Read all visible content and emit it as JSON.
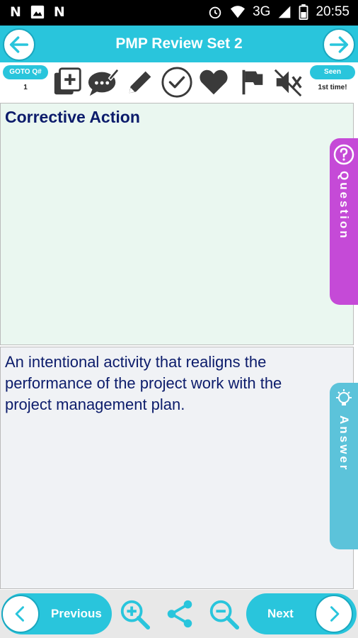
{
  "status_bar": {
    "left_icons": [
      "N",
      "N"
    ],
    "network": "3G",
    "time": "20:55"
  },
  "header": {
    "title": "PMP Review Set 2",
    "back_icon": "arrow-left-icon",
    "forward_icon": "arrow-right-icon"
  },
  "toolbar": {
    "goto_label": "GOTO Q#",
    "goto_value": "1",
    "seen_label": "Seen",
    "seen_value": "1st time!",
    "tools": [
      "add-note-icon",
      "comment-icon",
      "pencil-icon",
      "check-circle-icon",
      "heart-icon",
      "flag-icon",
      "mute-icon"
    ]
  },
  "question": {
    "text": "Corrective Action",
    "tab_label": "Question"
  },
  "answer": {
    "text": "An intentional activity that realigns the performance of the project work with the project management plan.",
    "tab_label": "Answer"
  },
  "bottom": {
    "previous_label": "Previous",
    "next_label": "Next"
  },
  "colors": {
    "accent": "#29c5dc",
    "question_tab": "#c54ad7",
    "answer_tab": "#5cc3da",
    "text_dark": "#0c1c6b"
  }
}
